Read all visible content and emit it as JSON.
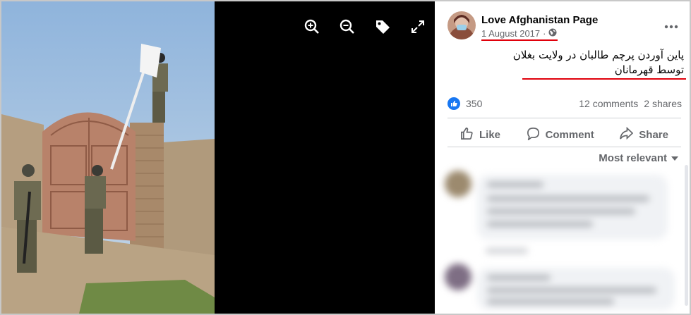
{
  "viewer": {
    "controls": [
      {
        "name": "zoom-in-icon"
      },
      {
        "name": "zoom-out-icon"
      },
      {
        "name": "tag-icon"
      },
      {
        "name": "fullscreen-icon"
      }
    ]
  },
  "post": {
    "author": "Love Afghanistan Page",
    "date": "1 August 2017",
    "separator": "·",
    "privacy_icon": "globe-icon",
    "more_icon": "more-options-icon",
    "caption_line1": "پاین آوردن پرچم طالبان در ولایت بغلان",
    "caption_line2": "توسط قهرمانان",
    "highlight_color": "#e0000b"
  },
  "stats": {
    "likes": "350",
    "comments": "12 comments",
    "shares": "2 shares",
    "like_color": "#1877f2"
  },
  "actions": {
    "like": "Like",
    "comment": "Comment",
    "share": "Share"
  },
  "sort": {
    "label": "Most relevant"
  }
}
